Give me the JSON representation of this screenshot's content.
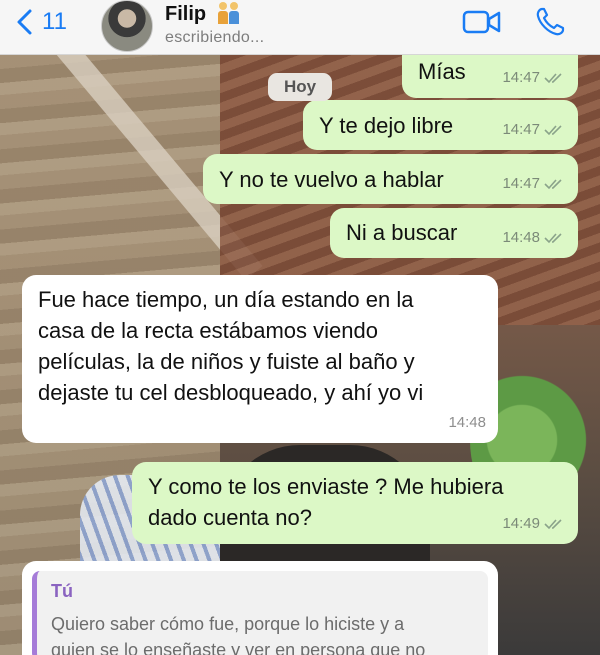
{
  "header": {
    "back_count": "11",
    "contact_name": "Filip",
    "status": "escribiendo..."
  },
  "date_pill": "Hoy",
  "messages": [
    {
      "text": "Mías",
      "time": "14:47",
      "direction": "out",
      "read": true
    },
    {
      "text": "Y te dejo libre",
      "time": "14:47",
      "direction": "out",
      "read": true
    },
    {
      "text": "Y no te vuelvo a hablar",
      "time": "14:47",
      "direction": "out",
      "read": true
    },
    {
      "text": "Ni a buscar",
      "time": "14:48",
      "direction": "out",
      "read": true
    },
    {
      "lines": [
        "Fue hace tiempo, un día estando en la",
        "casa de la recta estábamos viendo",
        "películas, la de niños y fuiste al baño y",
        "dejaste tu cel desbloqueado, y ahí yo vi"
      ],
      "time": "14:48",
      "direction": "in"
    },
    {
      "lines": [
        "Y como te los enviaste ? Me hubiera",
        "dado cuenta no?"
      ],
      "time": "14:49",
      "direction": "out",
      "read": true
    }
  ],
  "reply_quote": {
    "author": "Tú",
    "lines": [
      "Quiero saber cómo fue, porque lo hiciste y a",
      "quien se lo enseñaste y ver en persona que no"
    ]
  },
  "colors": {
    "outgoing_bubble": "#dcf8c6",
    "incoming_bubble": "#ffffff",
    "accent": "#1a7cf4",
    "quote_bar": "#a57bd8"
  }
}
